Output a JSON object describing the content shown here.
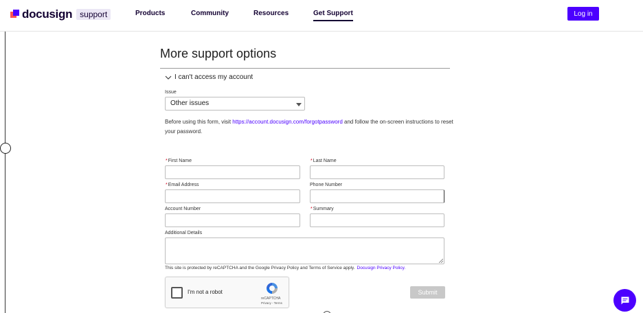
{
  "header": {
    "logo_word": "docusign",
    "logo_support": "support",
    "nav": [
      "Products",
      "Community",
      "Resources",
      "Get Support"
    ],
    "login_label": "Log in"
  },
  "main": {
    "title": "More support options",
    "accordion_label": "I can't access my account",
    "issue_label": "Issue",
    "issue_value": "Other issues",
    "info_before": "Before using this form, visit ",
    "info_link": "https://account.docusign.com/forgotpassword",
    "info_after": " and follow the on-screen instructions to reset your password."
  },
  "form": {
    "required_mark": "*",
    "first_name_label": "First Name",
    "last_name_label": "Last Name",
    "email_label": "Email Address",
    "phone_label": "Phone Number",
    "account_label": "Account Number",
    "summary_label": "Summary",
    "details_label": "Additional Details",
    "recaptcha_notice": "This site is protected by reCAPTCHA and the Google Privacy Policy and Terms of Service apply.",
    "privacy_link": "Docusign Privacy Policy.",
    "robot_label": "I'm not a robot",
    "recaptcha_name": "reCAPTCHA",
    "recaptcha_links": "Privacy - Terms",
    "submit_label": "Submit"
  },
  "colors": {
    "brand": "#4c00ff",
    "required": "#d0021b",
    "submit_disabled": "#c8c8c8"
  },
  "icons": {
    "chevron": "chevron-down-icon",
    "chat": "chat-icon",
    "recaptcha": "recaptcha-logo-icon"
  }
}
